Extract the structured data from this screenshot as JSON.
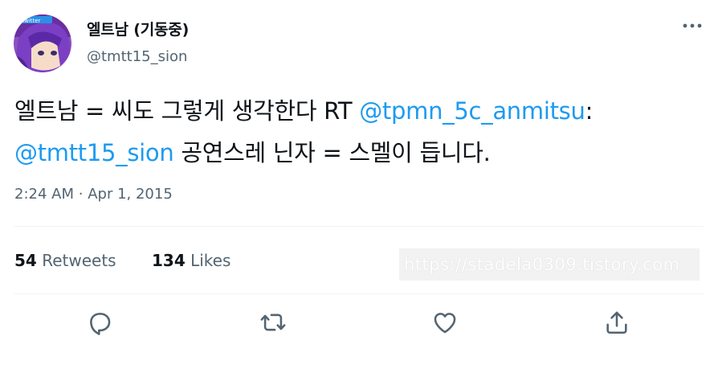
{
  "user": {
    "display_name": "엘트남 (기동중)",
    "handle": "@tmtt15_sion",
    "avatar_badge": "Twitter"
  },
  "tweet": {
    "text_line1_a": "엘트남 = 씨도 그렇게 생각한다 RT ",
    "mention1": "@tpmn_5c_anmitsu",
    "text_line1_b": ":",
    "mention2": "@tmtt15_sion",
    "text_line2": " 공연스레 닌자 = 스멜이 듭니다.",
    "time": "2:24 AM",
    "separator": "·",
    "date": "Apr 1, 2015"
  },
  "stats": {
    "retweets_count": "54",
    "retweets_label": "Retweets",
    "likes_count": "134",
    "likes_label": "Likes"
  },
  "watermark": "https://stadela0309.tistory.com",
  "colors": {
    "accent": "#1d9bf0",
    "text": "#0f1419",
    "secondary": "#536471",
    "divider": "#eff3f4"
  },
  "icons": [
    "more-icon",
    "reply-icon",
    "retweet-icon",
    "like-icon",
    "share-icon"
  ]
}
